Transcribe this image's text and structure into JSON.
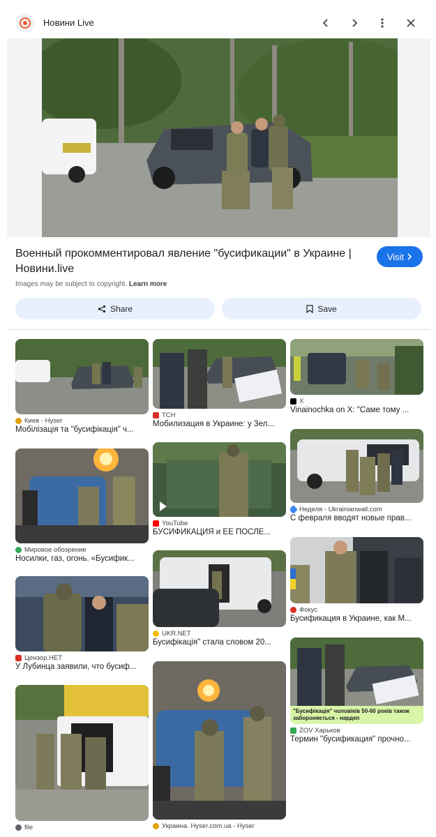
{
  "header": {
    "site_name": "Новини Live",
    "logo_icon": "site-logo-icon",
    "controls": [
      "chevron-left-icon",
      "chevron-right-icon",
      "more-vert-icon",
      "close-icon"
    ]
  },
  "hero": {
    "title": "Военный прокомментировал явление \"бусификации\" в Украине | Новини.live",
    "visit_label": "Visit",
    "copyright_note": "Images may be subject to copyright.",
    "learn_more": "Learn more",
    "share_label": "Share",
    "save_label": "Save"
  },
  "colors": {
    "accent": "#1a73e8",
    "chip_bg": "#e8f0fe",
    "brand": "#ea5b2c"
  },
  "results": {
    "col1": [
      {
        "source": "Киев - Hyser",
        "caption": "Мобілізація та \"бусифікація\" ч..."
      },
      {
        "source": "Мировое обозрение",
        "caption": "Носилки, газ, огонь. «Бусифик..."
      },
      {
        "source": "Цензор.НЕТ",
        "caption": "У Лубинца заявили, что бусиф..."
      },
      {
        "source": "file",
        "caption": ""
      }
    ],
    "col2": [
      {
        "source": "TCH",
        "caption": "Мобилизация в Украине: у Зел..."
      },
      {
        "source": "YouTube",
        "caption": "БУСИФИКАЦИЯ и ЕЕ ПОСЛЕ..."
      },
      {
        "source": "UKR.NET",
        "caption": "Бусифікація\" стала словом 20..."
      },
      {
        "source": "Украина. Hyser.com.ua - Hyser",
        "caption": ""
      }
    ],
    "col3": [
      {
        "source": "X",
        "caption": "Vinainochka on X: \"Саме тому ..."
      },
      {
        "source": "Неделя - Ukrainianwall.com",
        "caption": "С февраля вводят новые прав..."
      },
      {
        "source": "Фокус",
        "caption": "Бусификация в Украине, как М..."
      },
      {
        "source": "ZOV Харьков",
        "caption": "Термин \"бусификация\" прочно...",
        "overlay_text": "\"Бусифікація\" чоловіків 50-60 років також забороняється - нардеп"
      }
    ]
  }
}
